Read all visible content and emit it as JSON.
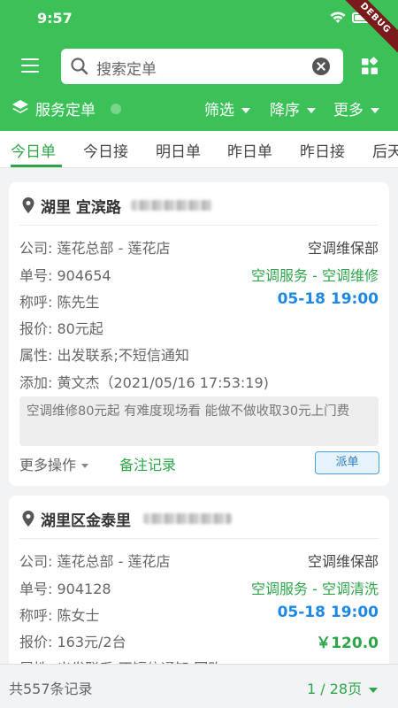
{
  "status_bar": {
    "time": "9:57",
    "debug_banner": "DEBUG"
  },
  "search": {
    "placeholder": "搜索定单"
  },
  "subbar": {
    "title": "服务定单",
    "filter_label": "筛选",
    "sort_label": "降序",
    "more_label": "更多"
  },
  "tabs": [
    {
      "label": "今日单",
      "active": true
    },
    {
      "label": "今日接"
    },
    {
      "label": "明日单"
    },
    {
      "label": "昨日单"
    },
    {
      "label": "昨日接"
    },
    {
      "label": "后天"
    }
  ],
  "orders": [
    {
      "address": "湖里 宜滨路",
      "company_label": "公司:",
      "company": "莲花总部 - 莲花店",
      "company_right": "空调维保部",
      "order_no_label": "单号:",
      "order_no": "904654",
      "service_type": "空调服务 - 空调维修",
      "name_label": "称呼:",
      "name": "陈先生",
      "datetime": "05-18 19:00",
      "price_label": "报价:",
      "price": "80元起",
      "attr_label": "属性:",
      "attributes": "出发联系;不短信通知",
      "added_label": "添加:",
      "added_by": "黄文杰（2021/05/16 17:53:19)",
      "note": "空调维修80元起 有难度现场看 能做不做收取30元上门费",
      "more_ops": "更多操作",
      "remark": "备注记录",
      "dispatch": "派单"
    },
    {
      "address": "湖里区金泰里",
      "company_label": "公司:",
      "company": "莲花总部 - 莲花店",
      "company_right": "空调维保部",
      "order_no_label": "单号:",
      "order_no": "904128",
      "service_type": "空调服务 - 空调清洗",
      "name_label": "称呼:",
      "name": "陈女士",
      "datetime": "05-18 19:00",
      "price_label": "报价:",
      "price": "163元/2台",
      "amount": "￥120.0",
      "attr_label": "属性:",
      "attributes": "出发联系;不短信通知;回购"
    }
  ],
  "footer": {
    "total": "共557条记录",
    "pager": "1 / 28页"
  },
  "colors": {
    "brand_green": "#3cc159",
    "accent_green": "#2fa54a",
    "time_blue": "#1e88e5"
  }
}
